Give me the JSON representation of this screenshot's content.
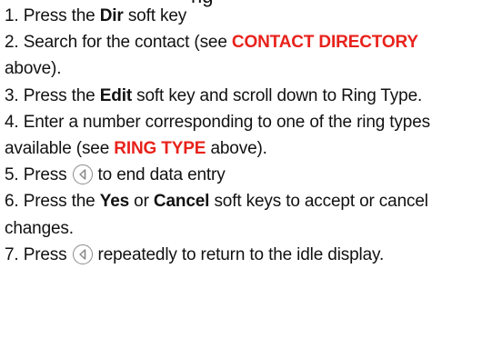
{
  "heading_fragment": "ng",
  "steps": [
    {
      "num": "1.",
      "t1": "Press the ",
      "b1": "Dir",
      "t2": " soft key"
    },
    {
      "num": "2.",
      "t1": "Search for the contact (see ",
      "r1": "CONTACT DIRECTORY",
      "t2": " above)."
    },
    {
      "num": "3.",
      "t1": "Press the ",
      "b1": "Edit",
      "t2": " soft key and scroll down to Ring Type."
    },
    {
      "num": "4.",
      "t1": "Enter a number corresponding to one of the ring types available (see ",
      "r1": "RING TYPE",
      "t2": " above)."
    },
    {
      "num": "5.",
      "t1": "Press",
      "icon": "back-key-icon",
      "t2": "to end data entry"
    },
    {
      "num": "6.",
      "t1": "Press the ",
      "b1": "Yes",
      "t2": " or ",
      "b2": "Cancel",
      "t3": " soft keys to accept or cancel changes."
    },
    {
      "num": "7.",
      "t1": "Press",
      "icon": "back-key-icon",
      "t2": "repeatedly to return to the idle display."
    }
  ],
  "colors": {
    "text": "#111111",
    "highlight": "#e8221b",
    "icon_stroke": "#8a8a8a"
  }
}
